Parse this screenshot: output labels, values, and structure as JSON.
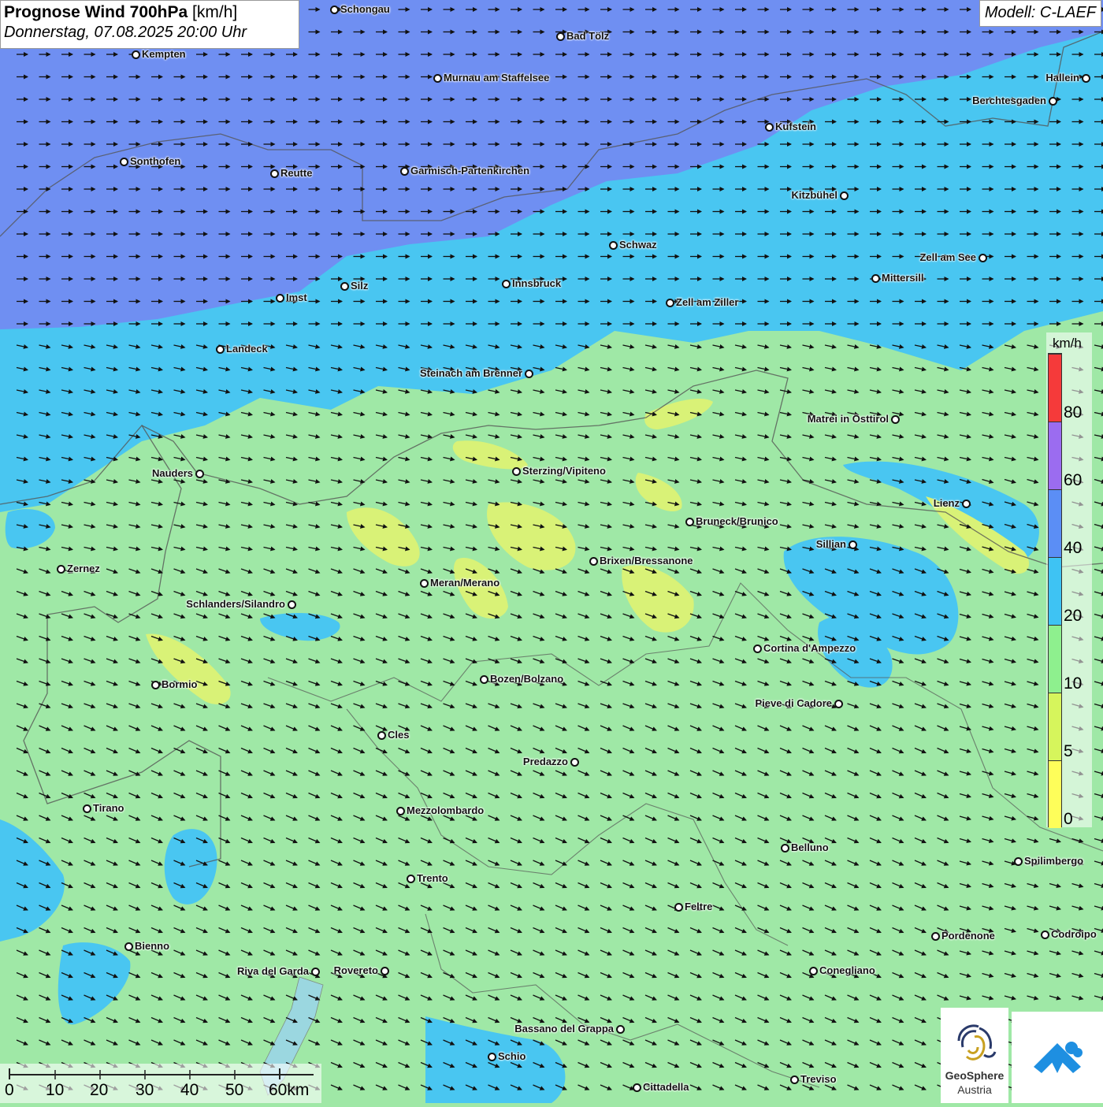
{
  "header": {
    "title_bold": "Prognose Wind 700hPa",
    "title_unit": " [km/h]",
    "subtitle": "Donnerstag, 07.08.2025 20:00 Uhr"
  },
  "model_label": "Modell: C-LAEF",
  "legend": {
    "unit": "km/h",
    "bands": [
      {
        "from": 0,
        "to": 5,
        "color": "#fefe5a"
      },
      {
        "from": 5,
        "to": 10,
        "color": "#d6f55c"
      },
      {
        "from": 10,
        "to": 20,
        "color": "#8ef08e"
      },
      {
        "from": 20,
        "to": 40,
        "color": "#3ec3f3"
      },
      {
        "from": 40,
        "to": 60,
        "color": "#5b8ef5"
      },
      {
        "from": 60,
        "to": 80,
        "color": "#9b6cf0"
      },
      {
        "from": 80,
        "to": 100,
        "color": "#f53a3a"
      }
    ],
    "ticks": [
      "0",
      "5",
      "10",
      "20",
      "40",
      "60",
      "80"
    ]
  },
  "scalebar": {
    "labels": [
      "0",
      "10",
      "20",
      "30",
      "40",
      "50",
      "60km"
    ]
  },
  "logos": {
    "geosphere_line1": "GeoSphere",
    "geosphere_line2": "Austria",
    "geosphere_icon": "geosphere-fingerprint-icon",
    "app_icon": "weather-app-icon"
  },
  "cities": [
    {
      "name": "Schongau"
    },
    {
      "name": "Bad Tölz"
    },
    {
      "name": "Kempten"
    },
    {
      "name": "Murnau am Staffelsee"
    },
    {
      "name": "Hallein"
    },
    {
      "name": "Berchtesgaden"
    },
    {
      "name": "Kufstein"
    },
    {
      "name": "Sonthofen"
    },
    {
      "name": "Reutte"
    },
    {
      "name": "Garmisch-Partenkirchen"
    },
    {
      "name": "Kitzbühel"
    },
    {
      "name": "Schwaz"
    },
    {
      "name": "Zell am See"
    },
    {
      "name": "Mittersill"
    },
    {
      "name": "Silz"
    },
    {
      "name": "Innsbruck"
    },
    {
      "name": "Imst"
    },
    {
      "name": "Zell am Ziller"
    },
    {
      "name": "Landeck"
    },
    {
      "name": "Steinach am Brenner"
    },
    {
      "name": "Matrei in Osttirol"
    },
    {
      "name": "Nauders"
    },
    {
      "name": "Sterzing/Vipiteno"
    },
    {
      "name": "Lienz"
    },
    {
      "name": "Bruneck/Brunico"
    },
    {
      "name": "Sillian"
    },
    {
      "name": "Zernez"
    },
    {
      "name": "Brixen/Bressanone"
    },
    {
      "name": "Meran/Merano"
    },
    {
      "name": "Schlanders/Silandro"
    },
    {
      "name": "Cortina d'Ampezzo"
    },
    {
      "name": "Bozen/Bolzano"
    },
    {
      "name": "Bormio"
    },
    {
      "name": "Pieve di Cadore"
    },
    {
      "name": "Cles"
    },
    {
      "name": "Predazzo"
    },
    {
      "name": "Tirano"
    },
    {
      "name": "Mezzolombardo"
    },
    {
      "name": "Belluno"
    },
    {
      "name": "Spilimbergo"
    },
    {
      "name": "Trento"
    },
    {
      "name": "Feltre"
    },
    {
      "name": "Pordenone"
    },
    {
      "name": "Codroipo"
    },
    {
      "name": "Bienno"
    },
    {
      "name": "Riva del Garda"
    },
    {
      "name": "Rovereto"
    },
    {
      "name": "Conegliano"
    },
    {
      "name": "Bassano del Grappa"
    },
    {
      "name": "Schio"
    },
    {
      "name": "Treviso"
    },
    {
      "name": "Cittadella"
    }
  ]
}
